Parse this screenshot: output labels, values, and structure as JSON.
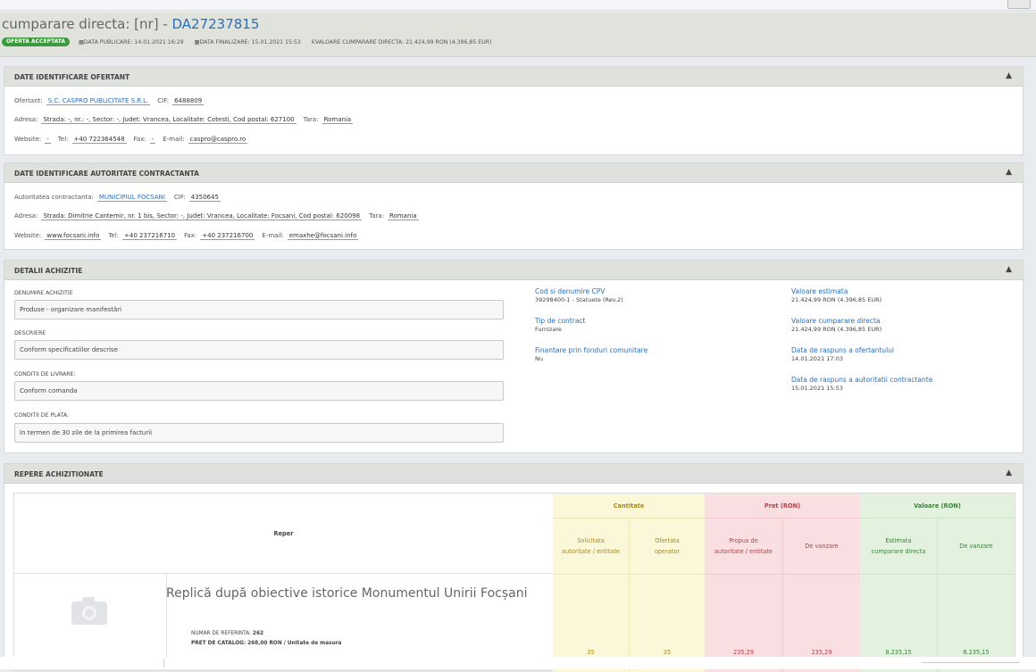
{
  "header": {
    "title_prefix": "cumparare directa: [nr] - ",
    "title_number": "DA27237815",
    "status_badge": "OFERTA ACCEPTATA",
    "meta": [
      "DATA PUBLICARE: 14.01.2021 16:29",
      "DATA FINALIZARE: 15.01.2021 15:53",
      "VALOARE CUMPARARE DIRECTA: 21.424,99 RON (4.396,85 EUR)"
    ]
  },
  "ofertant": {
    "panel_title": "DATE IDENTIFICARE OFERTANT",
    "ofertant_label": "Ofertant:",
    "ofertant_value": "S.C. CASPRO PUBLICITATE S.R.L.",
    "cif_label": "CIF:",
    "cif_value": "6488809",
    "adresa_label": "Adresa:",
    "adresa_value": "Strada: -, nr.: -, Sector: -, Judet: Vrancea, Localitate: Cotesti, Cod postal: 627100",
    "tara_label": "Tara:",
    "tara_value": "Romania",
    "website_label": "Website:",
    "website_value": "-",
    "tel_label": "Tel:",
    "tel_value": "+40 722364548",
    "fax_label": "Fax:",
    "fax_value": "-",
    "email_label": "E-mail:",
    "email_value": "caspro@caspro.ro"
  },
  "autoritate": {
    "panel_title": "DATE IDENTIFICARE AUTORITATE CONTRACTANTA",
    "autoritate_label": "Autoritatea contractanta:",
    "autoritate_value": "MUNICIPIUL FOCSANI",
    "cif_label": "CIF:",
    "cif_value": "4350645",
    "adresa_label": "Adresa:",
    "adresa_value": "Strada: Dimitrie Cantemir, nr. 1 bis, Sector: -, Judet: Vrancea, Localitate: Focsani, Cod postal: 620098",
    "tara_label": "Tara:",
    "tara_value": "Romania",
    "website_label": "Website:",
    "website_value": "www.focsani.info",
    "tel_label": "Tel:",
    "tel_value": "+40 237216710",
    "fax_label": "Fax:",
    "fax_value": "+40 237216700",
    "email_label": "E-mail:",
    "email_value": "emaxhe@focsani.info"
  },
  "detalii": {
    "panel_title": "DETALII ACHIZITIE",
    "denumire_label": "DENUMIRE ACHIZITIE",
    "denumire_value": "Produse - organizare manifestări",
    "descriere_label": "DESCRIERE",
    "descriere_value": "Conform specificatiilor descrise",
    "livrare_label": "CONDITII DE LIVRARE:",
    "livrare_value": "Conform comanda",
    "plata_label": "CONDITII DE PLATA:",
    "plata_value": "In termen de 30 zile de la primirea facturii",
    "cpv_label": "Cod si denumire CPV",
    "cpv_value": "39298400-1 - Statuete (Rev.2)",
    "tip_label": "Tip de contract",
    "tip_value": "Furnizare",
    "fonduri_label": "Finantare prin fonduri comunitare",
    "fonduri_value": "Nu",
    "val_est_label": "Valoare estimata",
    "val_est_value": "21.424,99 RON (4.396,85 EUR)",
    "val_cump_label": "Valoare cumparare directa",
    "val_cump_value": "21.424,99 RON (4.396,85 EUR)",
    "raspuns_of_label": "Data de raspuns a ofertantului",
    "raspuns_of_value": "14.01.2021 17:03",
    "raspuns_aut_label": "Data de raspuns a autoritatii contractante",
    "raspuns_aut_value": "15.01.2021 15:53"
  },
  "repere": {
    "panel_title": "REPERE ACHIZITIONATE",
    "col_reper": "Reper",
    "group_cantitate": "Cantitate",
    "group_pret": "Pret (RON)",
    "group_valoare": "Valoare (RON)",
    "sub_solicitata": "Solicitata autoritate / entitate",
    "sub_ofertata": "Ofertata operator",
    "sub_propus": "Propus de autoritate / entitate",
    "sub_de_vanzare_pret": "De vanzare",
    "sub_estimata": "Estimata cumparare directa",
    "sub_de_vanzare_val": "De vanzare",
    "item": {
      "title": "Replică după obiective istorice Monumentul Unirii Focșani",
      "ref_label": "NUMAR DE REFERINTA:",
      "ref_value": "262",
      "pret_label": "PRET DE CATALOG:",
      "pret_value": "268,00 RON / Unitate de masura",
      "solicitata": "35",
      "ofertata": "35",
      "propus": "235,29",
      "de_vanzare_pret": "235,29",
      "estimata": "8.235,15",
      "de_vanzare_val": "8.235,15"
    }
  }
}
